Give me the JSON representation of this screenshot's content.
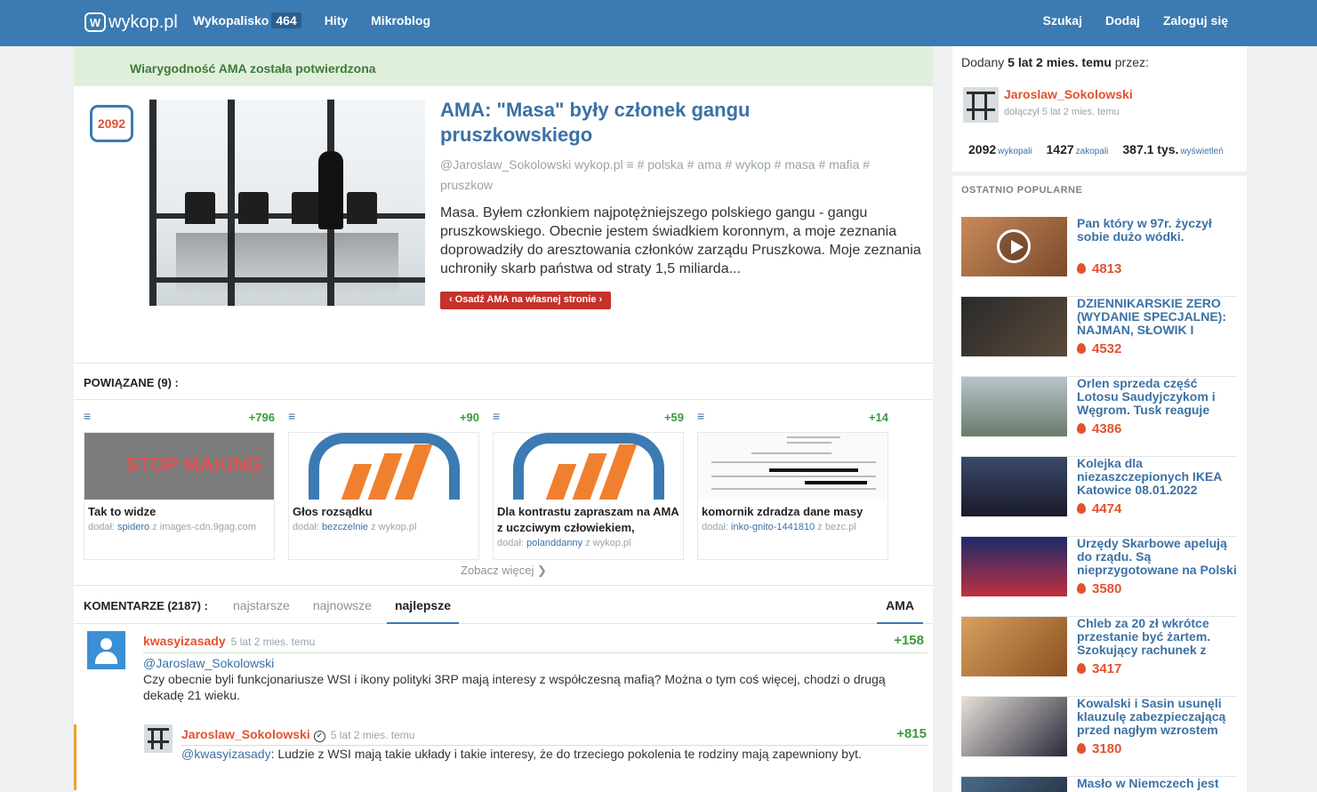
{
  "topbar": {
    "logo": "wykop.pl",
    "nav": [
      {
        "label": "Wykopalisko",
        "badge": "464"
      },
      {
        "label": "Hity"
      },
      {
        "label": "Mikroblog"
      }
    ],
    "right": [
      "Szukaj",
      "Dodaj",
      "Zaloguj się"
    ]
  },
  "article": {
    "verified": "Wiarygodność AMA została potwierdzona",
    "votes": "2092",
    "title": "AMA: \"Masa\" były członek gangu pruszkowskiego",
    "meta": "@Jaroslaw_Sokolowski  wykop.pl  ≡ # polska # ama # wykop # masa # mafia # pruszkow",
    "description": "Masa. Byłem członkiem najpotężniejszego polskiego gangu - gangu pruszkowskiego. Obecnie jestem świadkiem koronnym, a moje zeznania doprowadziły do aresztowania członków zarządu Pruszkowa. Moje zeznania uchroniły skarb państwa od straty 1,5 miliarda...",
    "embed_button": "‹ Osadź AMA na własnej stronie ›"
  },
  "related": {
    "heading": "POWIĄZANE (9) :",
    "more": "Zobacz więcej ❯",
    "cards": [
      {
        "votes": "+796",
        "title": "Tak to widze",
        "added_by": "dodał:",
        "user": "spidero",
        "source": "z images-cdn.9gag.com",
        "thumb_text": "STOP MAKING"
      },
      {
        "votes": "+90",
        "title": "Głos rozsądku",
        "added_by": "dodał:",
        "user": "bezczelnie",
        "source": "z wykop.pl"
      },
      {
        "votes": "+59",
        "title": "Dla kontrastu zapraszam na AMA z uczciwym człowiekiem,",
        "added_by": "dodał:",
        "user": "polanddanny",
        "source": "z wykop.pl"
      },
      {
        "votes": "+14",
        "title": "komornik zdradza dane masy",
        "added_by": "dodał:",
        "user": "inko-gnito-1441810",
        "source": "z bezc.pl"
      }
    ]
  },
  "comments": {
    "heading": "KOMENTARZE (2187) :",
    "tabs": [
      "najstarsze",
      "najnowsze",
      "najlepsze"
    ],
    "active_tab": "najlepsze",
    "ama_tab": "AMA",
    "top": {
      "user": "kwasyizasady",
      "time": "5 lat 2 mies. temu",
      "votes": "+158",
      "mention": "@Jaroslaw_Sokolowski",
      "body": "Czy obecnie byli funkcjonariusze WSI i ikony polityki 3RP mają interesy z współczesną mafią? Można o tym coś więcej, chodzi o drugą dekadę 21 wieku."
    },
    "reply": {
      "user": "Jaroslaw_Sokolowski",
      "time": "5 lat 2 mies. temu",
      "votes": "+815",
      "mention": "@kwasyizasady",
      "body": ": Ludzie z WSI mają takie układy i takie interesy, że do trzeciego pokolenia te rodziny mają zapewniony byt."
    }
  },
  "sidebar": {
    "added_prefix": "Dodany ",
    "added_time": "5 lat 2 mies. temu",
    "added_suffix": " przez:",
    "author": "Jaroslaw_Sokolowski",
    "joined": "dołączył 5 lat 2 mies. temu",
    "stats": [
      {
        "value": "2092",
        "label": "wykopali"
      },
      {
        "value": "1427",
        "label": "zakopali"
      },
      {
        "value": "387.1 tys.",
        "label": "wyświetleń"
      }
    ],
    "popular_heading": "OSTATNIO POPULARNE",
    "popular": [
      {
        "title": "Pan który w 97r. życzył sobie dużo wódki.",
        "votes": "4813"
      },
      {
        "title": "DZIENNIKARSKIE ZERO (WYDANIE SPECJALNE): NAJMAN, SŁOWIK I",
        "votes": "4532"
      },
      {
        "title": "Orlen sprzeda część Lotosu Saudyjczykom i Węgrom. Tusk reaguje",
        "votes": "4386"
      },
      {
        "title": "Kolejka dla niezaszczepionych IKEA Katowice 08.01.2022",
        "votes": "4474"
      },
      {
        "title": "Urzędy Skarbowe apelują do rządu. Są nieprzygotowane na Polski Ład.",
        "votes": "3580"
      },
      {
        "title": "Chleb za 20 zł wkrótce przestanie być żartem. Szokujący rachunek z",
        "votes": "3417"
      },
      {
        "title": "Kowalski i Sasin usunęli klauzulę zabezpieczającą przed nagłym wzrostem cen",
        "votes": "3180"
      },
      {
        "title": "Masło w Niemczech jest już",
        "votes": ""
      }
    ]
  }
}
